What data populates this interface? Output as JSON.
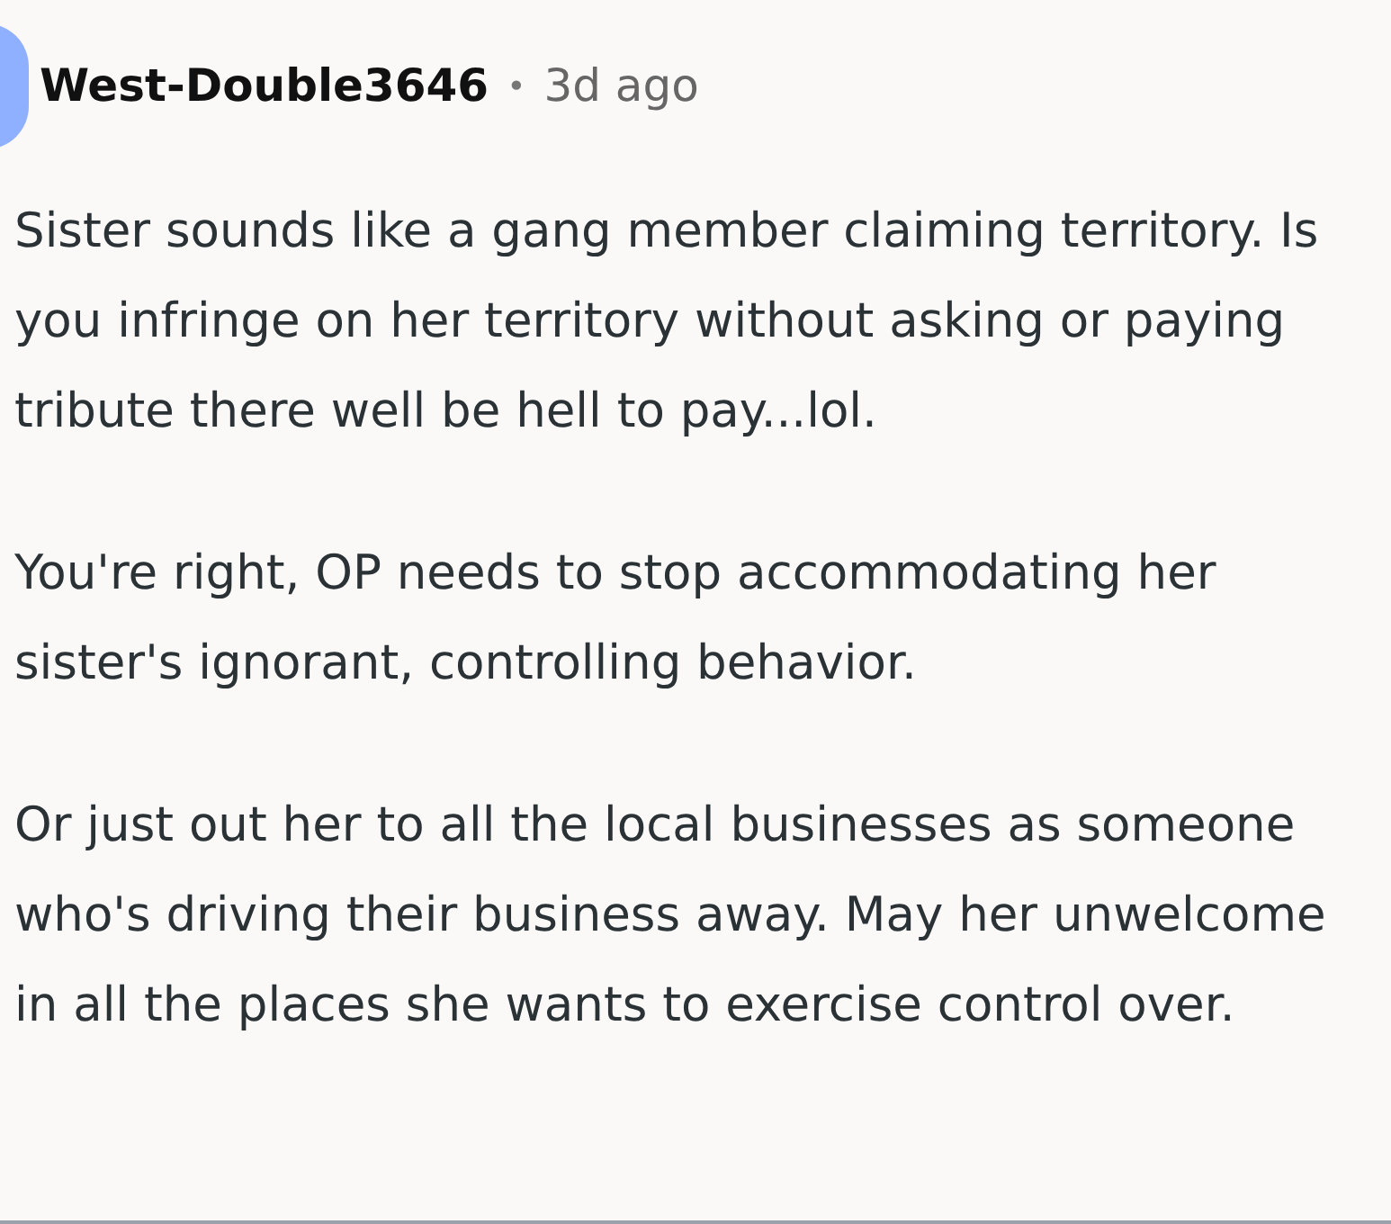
{
  "comment": {
    "author": "West-Double3646",
    "separator": "•",
    "time": "3d ago",
    "paragraphs": [
      "Sister sounds like a gang member claiming territory. Is you infringe on her territory without asking or paying tribute there well be hell to pay...lol.",
      "You're right, OP needs to stop accommodating her sister's ignorant, controlling behavior.",
      "Or just out her to all the local businesses as someone who's driving their business away. May her unwelcome in all the places she wants to exercise control over."
    ]
  }
}
